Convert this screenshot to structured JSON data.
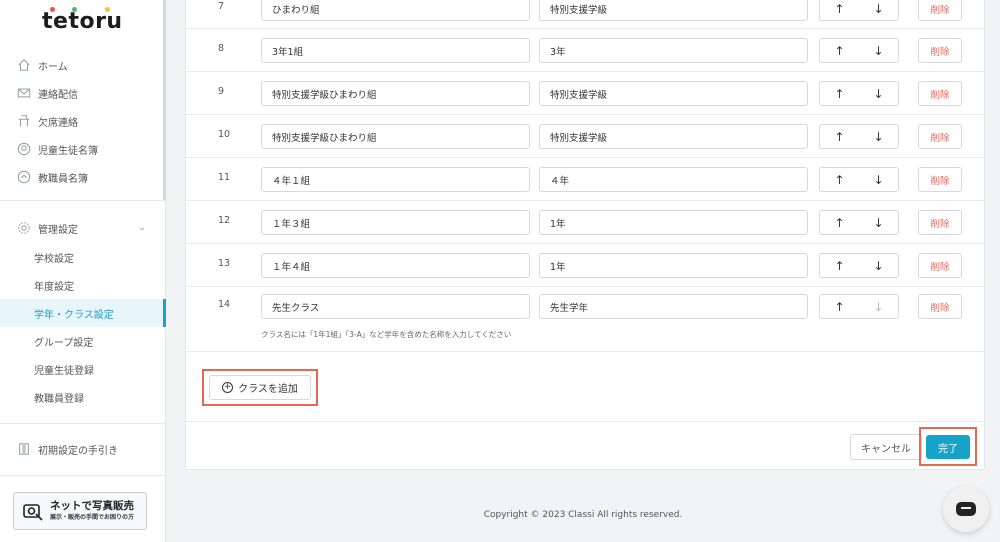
{
  "sidebar": {
    "logo": "tetoru",
    "nav": [
      {
        "label": "ホーム",
        "icon": "home-icon"
      },
      {
        "label": "連絡配信",
        "icon": "mail-icon"
      },
      {
        "label": "欠席連絡",
        "icon": "desk-icon"
      },
      {
        "label": "児童生徒名簿",
        "icon": "student-icon"
      },
      {
        "label": "教職員名簿",
        "icon": "teacher-icon"
      }
    ],
    "admin": {
      "label": "管理設定",
      "icon": "gear-icon"
    },
    "sub_items": [
      {
        "label": "学校設定",
        "active": false
      },
      {
        "label": "年度設定",
        "active": false
      },
      {
        "label": "学年・クラス設定",
        "active": true
      },
      {
        "label": "グループ設定",
        "active": false
      },
      {
        "label": "児童生徒登録",
        "active": false
      },
      {
        "label": "教職員登録",
        "active": false
      }
    ],
    "guide": {
      "label": "初期設定の手引き",
      "icon": "book-icon"
    },
    "banner": {
      "title": "ネットで写真販売",
      "subtitle": "展示・販売の手間でお困りの方"
    }
  },
  "rows": [
    {
      "num": "7",
      "class_name": "ひまわり組",
      "grade": "特別支援学級",
      "up_enabled": true,
      "down_enabled": true
    },
    {
      "num": "8",
      "class_name": "3年1組",
      "grade": "3年",
      "up_enabled": true,
      "down_enabled": true
    },
    {
      "num": "9",
      "class_name": "特別支援学級ひまわり組",
      "grade": "特別支援学級",
      "up_enabled": true,
      "down_enabled": true
    },
    {
      "num": "10",
      "class_name": "特別支援学級ひまわり組",
      "grade": "特別支援学級",
      "up_enabled": true,
      "down_enabled": true
    },
    {
      "num": "11",
      "class_name": "４年１組",
      "grade": "４年",
      "up_enabled": true,
      "down_enabled": true
    },
    {
      "num": "12",
      "class_name": "１年３組",
      "grade": "1年",
      "up_enabled": true,
      "down_enabled": true
    },
    {
      "num": "13",
      "class_name": "１年４組",
      "grade": "1年",
      "up_enabled": true,
      "down_enabled": true
    },
    {
      "num": "14",
      "class_name": "先生クラス",
      "grade": "先生学年",
      "up_enabled": true,
      "down_enabled": false
    }
  ],
  "labels": {
    "up": "↑",
    "down": "↓",
    "delete": "削除",
    "hint": "クラス名には「1年1組」「3-A」など学年を含めた名称を入力してください",
    "add_class": "クラスを追加",
    "cancel": "キャンセル",
    "done": "完了"
  },
  "footer": {
    "copyright": "Copyright © 2023 Classi All rights reserved."
  },
  "colors": {
    "accent": "#16a3c9",
    "highlight": "#e8674f",
    "delete": "#e8645a"
  }
}
